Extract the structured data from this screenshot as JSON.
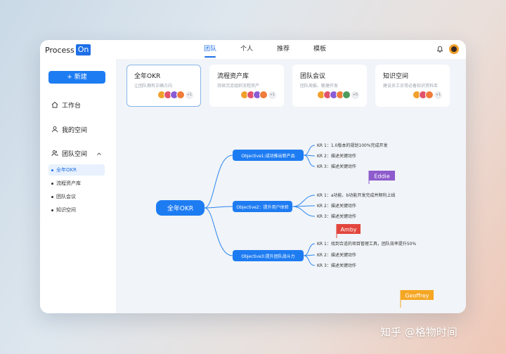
{
  "app": {
    "logo_text": "Process",
    "logo_badge": "On",
    "nav": [
      "团队",
      "个人",
      "推荐",
      "模板"
    ],
    "active_nav": 0
  },
  "sidebar": {
    "new_label": "+ 新建",
    "items": [
      {
        "label": "工作台",
        "icon": "home-icon"
      },
      {
        "label": "我的空间",
        "icon": "user-icon"
      },
      {
        "label": "团队空间",
        "icon": "team-icon"
      }
    ],
    "sub_items": [
      "全年OKR",
      "流程资产库",
      "团队会议",
      "知识空间"
    ],
    "active_sub": 0
  },
  "cards": [
    {
      "title": "全年OKR",
      "subtitle": "让团队拥有正确方向",
      "more": "+1"
    },
    {
      "title": "流程资产库",
      "subtitle": "持续沉淀组织流程资产",
      "more": "+1"
    },
    {
      "title": "团队会议",
      "subtitle": "团队周报、敏捷开发",
      "more": "+5"
    },
    {
      "title": "知识空间",
      "subtitle": "建设员工日常必备知识资料库",
      "more": "+1"
    }
  ],
  "colors": {
    "accent": "#1e7cf2",
    "avatar_colors": [
      "#f0a02a",
      "#e2536b",
      "#8a5cd6",
      "#f07b3a"
    ],
    "eddie": "#8e5bcc",
    "amby": "#e2453c",
    "geoffrey": "#f5a623"
  },
  "mindmap": {
    "root": "全年OKR",
    "objectives": [
      {
        "label": "Objective1:成功推出新产品",
        "krs": [
          "KR 1：1.0版本的规划100%完成开发",
          "KR 2：描述关键动作",
          "KR 3：描述关键动作"
        ]
      },
      {
        "label": "Objective2：提升用户体验",
        "krs": [
          "KR 1：a功能、b功能开发完成并顺利上线",
          "KR 2：描述关键动作",
          "KR 3：描述关键动作"
        ]
      },
      {
        "label": "Objective3:提升团队战斗力",
        "krs": [
          "KR 1：找到合适的项目管理工具，团队效率提升50%",
          "KR 2：描述关键动作",
          "KR 3：描述关键动作"
        ]
      }
    ],
    "cursors": [
      {
        "name": "Eddie",
        "color_key": "eddie"
      },
      {
        "name": "Amby",
        "color_key": "amby"
      },
      {
        "name": "Geoffrey",
        "color_key": "geoffrey"
      }
    ]
  },
  "watermark": "知乎 @格物时间"
}
